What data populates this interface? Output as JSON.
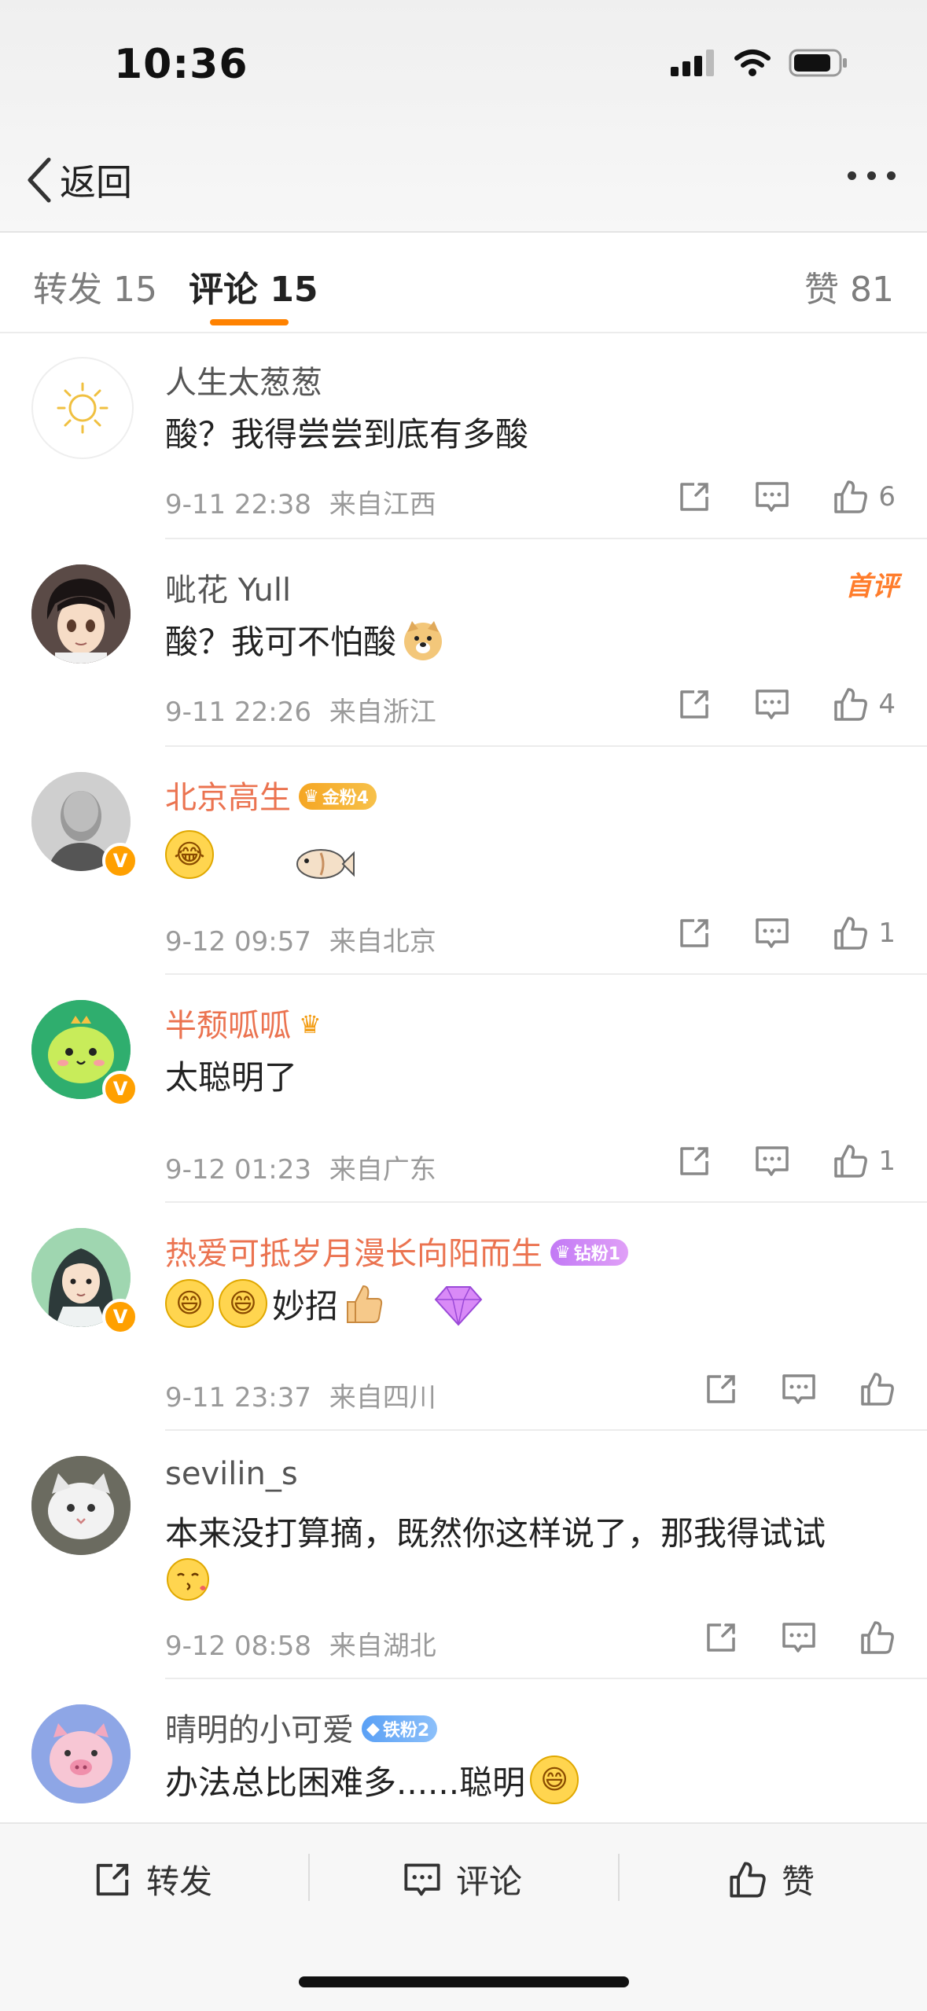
{
  "status_bar": {
    "time": "10:36"
  },
  "header": {
    "back_label": "返回"
  },
  "tabs": [
    {
      "label": "转发 15"
    },
    {
      "label": "评论 15"
    },
    {
      "label": "赞 81"
    }
  ],
  "comments": [
    {
      "name": "人生太葱葱",
      "text": "酸？我得尝尝到底有多酸",
      "time": "9-11 22:38",
      "location": "来自江西",
      "likes": "6"
    },
    {
      "name": "呲花 Yull",
      "text": "酸？我可不怕酸",
      "time": "9-11 22:26",
      "location": "来自浙江",
      "likes": "4",
      "tag": "首评"
    },
    {
      "name": "北京高生",
      "badge": "金粉4",
      "time": "9-12 09:57",
      "location": "来自北京",
      "likes": "1"
    },
    {
      "name": "半颓呱呱",
      "text": "太聪明了",
      "time": "9-12 01:23",
      "location": "来自广东",
      "likes": "1"
    },
    {
      "name": "热爱可抵岁月漫长向阳而生",
      "badge": "钻粉1",
      "text": "妙招",
      "time": "9-11 23:37",
      "location": "来自四川"
    },
    {
      "name": "sevilin_s",
      "text": "本来没打算摘，既然你这样说了，那我得试试",
      "time": "9-12 08:58",
      "location": "来自湖北"
    },
    {
      "name": "晴明的小可爱",
      "badge": "铁粉2",
      "text": "办法总比困难多......聪明"
    }
  ],
  "bottom_bar": {
    "repost": "转发",
    "comment": "评论",
    "like": "赞"
  },
  "colors": {
    "accent": "#ff8200",
    "vip_name": "#eb7350"
  }
}
